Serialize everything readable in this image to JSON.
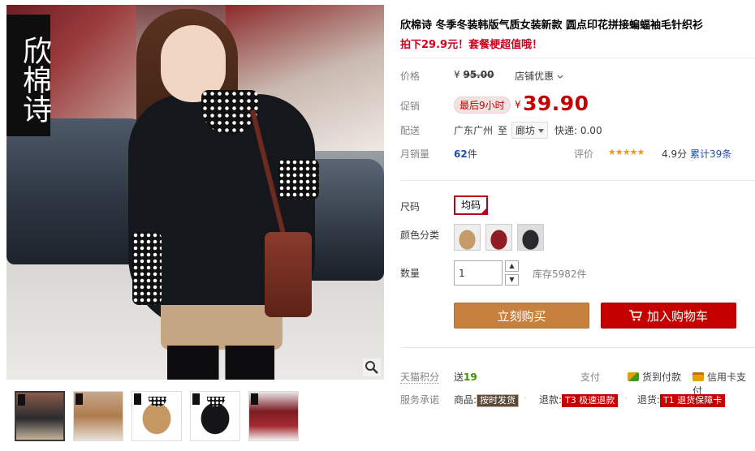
{
  "gallery": {
    "brand_text": "欣棉诗",
    "thumbnails": [
      "thumb-1",
      "thumb-2",
      "thumb-3",
      "thumb-4",
      "thumb-5"
    ],
    "active_thumbnail": 1
  },
  "product": {
    "title": "欣棉诗 冬季冬装韩版气质女装新款 圆点印花拼接蝙蝠袖毛针织衫",
    "subtitle": "拍下29.9元！套餐梗超值哦！"
  },
  "price": {
    "label": "价格",
    "currency": "¥",
    "original": "95.00",
    "shop_discount": "店铺优惠",
    "promo_label": "促销",
    "promo_tag": "最后9小时",
    "current_currency": "¥",
    "current": "39.90"
  },
  "shipping": {
    "label": "配送",
    "from": "广东广州",
    "to_word": "至",
    "dest": "廊坊",
    "fee": "快递: 0.00"
  },
  "sales": {
    "label": "月销量",
    "count": "62",
    "unit": "件",
    "rating_label": "评价",
    "stars": "★★★★★",
    "score": "4.9分",
    "reviews": "累计39条"
  },
  "sku": {
    "size_label": "尺码",
    "size_value": "均码",
    "color_label": "颜色分类",
    "colors": [
      "camel",
      "wine-red",
      "black"
    ],
    "qty_label": "数量",
    "qty_value": "1",
    "stock": "库存5982件"
  },
  "actions": {
    "buy_now": "立刻购买",
    "add_to_cart": "加入购物车"
  },
  "services": {
    "points_label": "天猫积分",
    "points_give": "送",
    "points_value": "19",
    "pay_label": "支付",
    "pay_cod": "货到付款",
    "pay_card": "信用卡支付",
    "promise_label": "服务承诺",
    "goods_label": "商品:",
    "goods_chip": "按时发货",
    "refund_label": "退款:",
    "refund_chip": "T3 极速退款",
    "return_label": "退货:",
    "return_chip": "T1 退货保障卡"
  },
  "colors": {
    "price_red": "#c40000",
    "buy_orange": "#c6813f",
    "cart_red": "#c40000",
    "link_blue": "#1f4fa3",
    "points_green": "#3c8f00"
  }
}
